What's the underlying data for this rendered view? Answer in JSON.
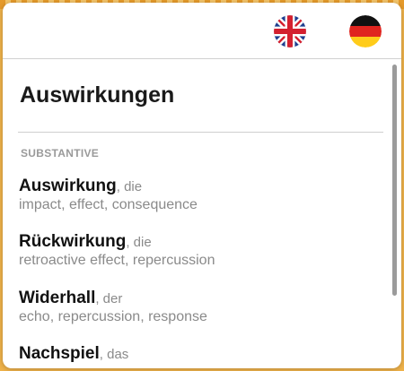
{
  "header": {
    "flags": [
      {
        "name": "english-flag-icon",
        "language": "English"
      },
      {
        "name": "german-flag-icon",
        "language": "German"
      }
    ]
  },
  "main": {
    "title": "Auswirkungen",
    "section": "SUBSTANTIVE",
    "entries": [
      {
        "word": "Auswirkung",
        "article": ", die",
        "translations": "impact, effect, consequence"
      },
      {
        "word": "Rückwirkung",
        "article": ", die",
        "translations": "retroactive effect, repercussion"
      },
      {
        "word": "Widerhall",
        "article": ", der",
        "translations": "echo, repercussion, response"
      },
      {
        "word": "Nachspiel",
        "article": ", das",
        "translations": ""
      }
    ]
  },
  "colors": {
    "page_background": "#efb24a",
    "popup_background": "#ffffff",
    "muted_text": "#8a8a8a",
    "heading_text": "#1a1a1a"
  }
}
